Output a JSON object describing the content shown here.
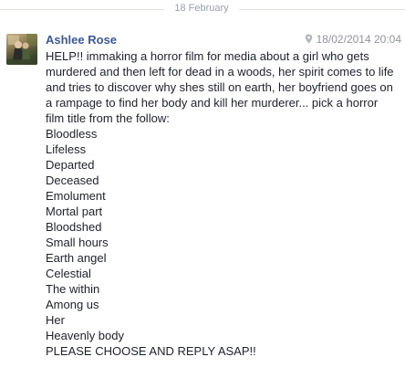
{
  "divider": {
    "date": "18 February"
  },
  "message": {
    "sender": "Ashlee Rose",
    "timestamp": "18/02/2014 20:04",
    "location_icon": "map-pin-icon",
    "intro": "HELP!! immaking a horror film for media about a girl who gets murdered and then left for dead in a woods, her spirit comes to life and tries to discover why shes still on earth, her boyfriend goes on a rampage to find her body and kill her murderer... pick a horror film title from the follow:",
    "options": [
      "Bloodless",
      "Lifeless",
      "Departed",
      "Deceased",
      "Emolument",
      "Mortal part",
      "Bloodshed",
      "Small hours",
      "Earth angel",
      "Celestial",
      "The within",
      "Among us",
      "Her",
      "Heavenly body"
    ],
    "closing": "PLEASE CHOOSE AND REPLY ASAP!!"
  },
  "colors": {
    "sender_name": "#3b5998",
    "meta_text": "#90949c",
    "body_text": "#1d2129",
    "divider_line": "#dfe1e6"
  }
}
